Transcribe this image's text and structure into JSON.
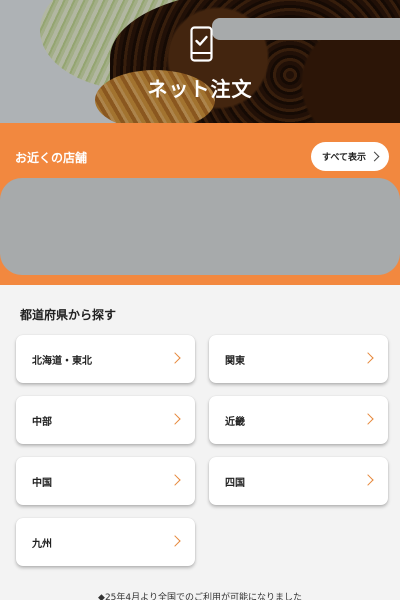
{
  "hero": {
    "title": "ネット注文",
    "icon": "phone-check-icon"
  },
  "nearby": {
    "title": "お近くの店舗",
    "view_all_label": "すべて表示"
  },
  "prefecture": {
    "title": "都道府県から探す",
    "regions": [
      {
        "label": "北海道・東北"
      },
      {
        "label": "関東"
      },
      {
        "label": "中部"
      },
      {
        "label": "近畿"
      },
      {
        "label": "中国"
      },
      {
        "label": "四国"
      },
      {
        "label": "九州"
      }
    ]
  },
  "footer": {
    "note": "◆25年4月より全国でのご利用が可能になりました"
  },
  "colors": {
    "accent": "#f2883f",
    "chevron": "#e6873a",
    "redaction": "#a7aaab"
  }
}
